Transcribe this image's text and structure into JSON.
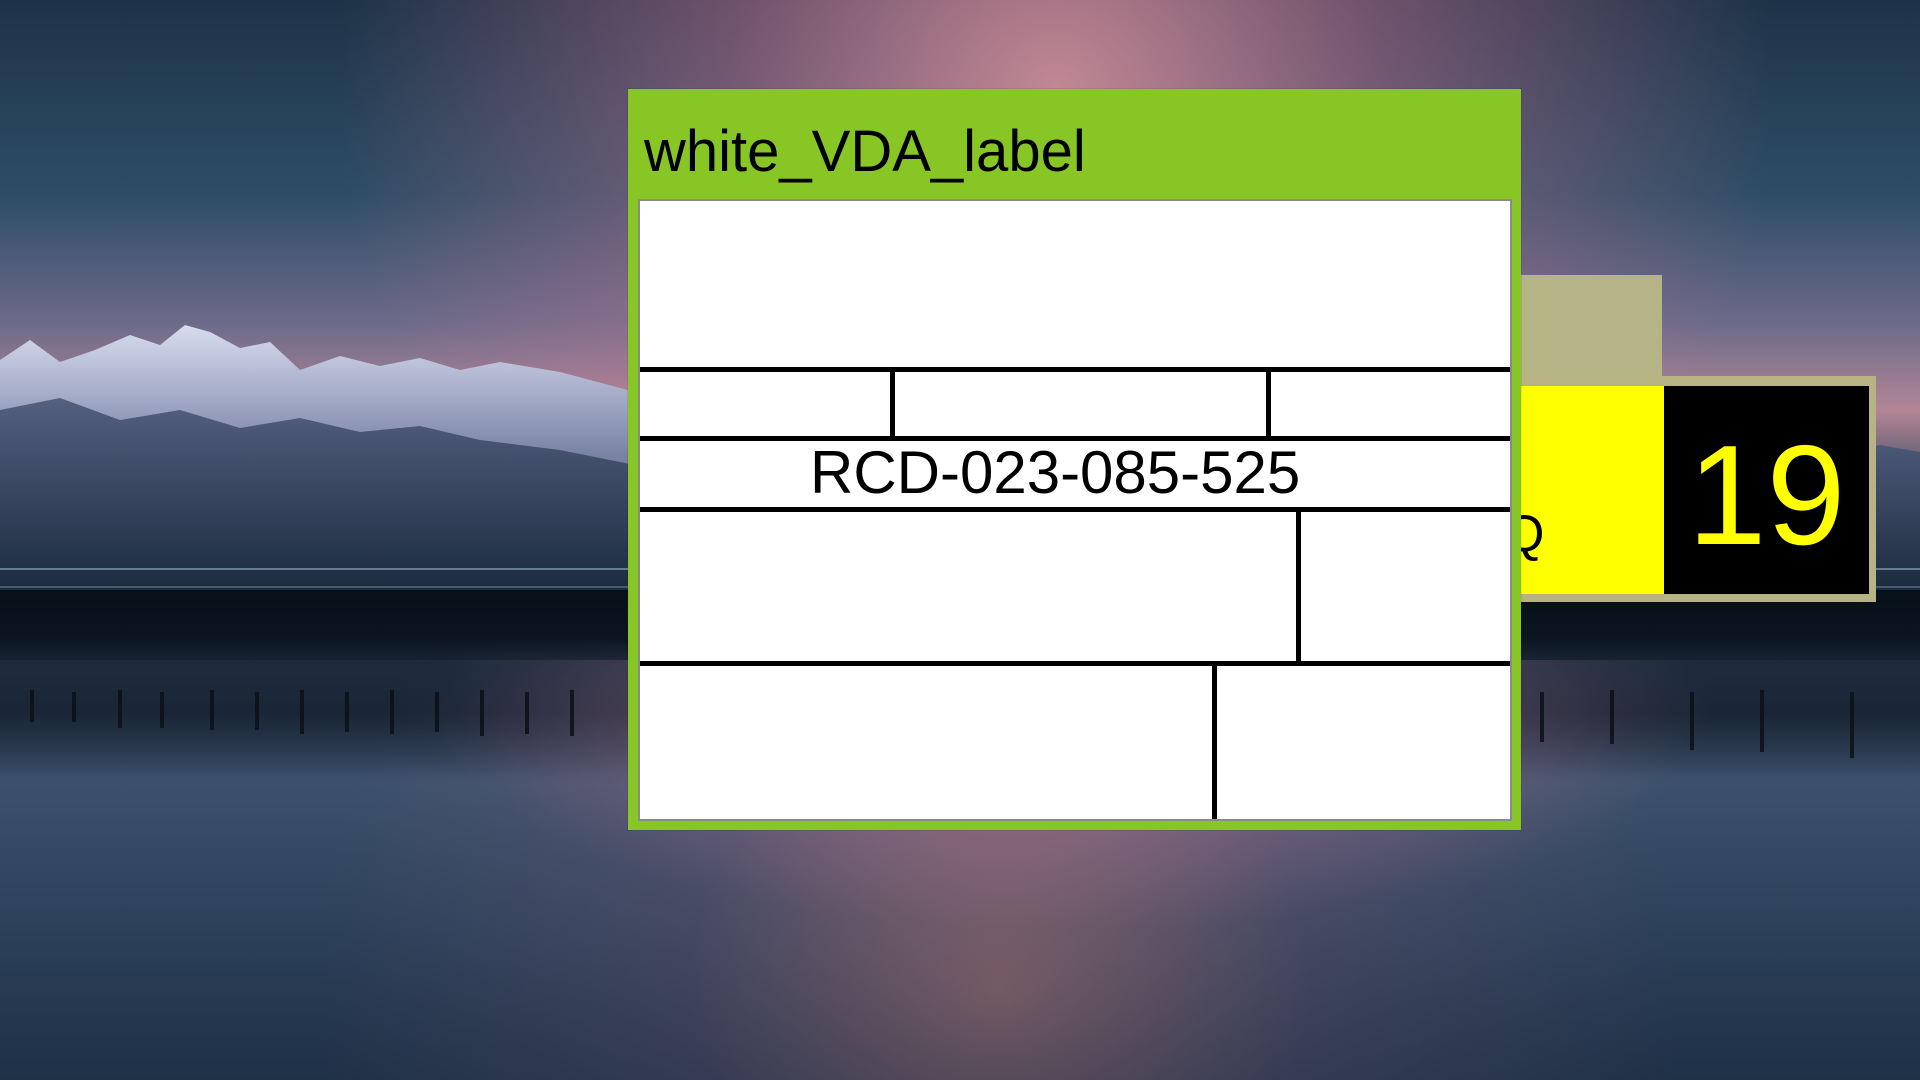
{
  "label_window": {
    "title": "white_VDA_label",
    "serial_text": "RCD-023-085-525"
  },
  "sign": {
    "number": "19",
    "partial_glyph": "Q",
    "colors": {
      "panel": "#b7b385",
      "yellow": "#ffff00",
      "black": "#000000"
    }
  },
  "theme": {
    "window_frame": "#87c625",
    "label_background": "#ffffff"
  }
}
